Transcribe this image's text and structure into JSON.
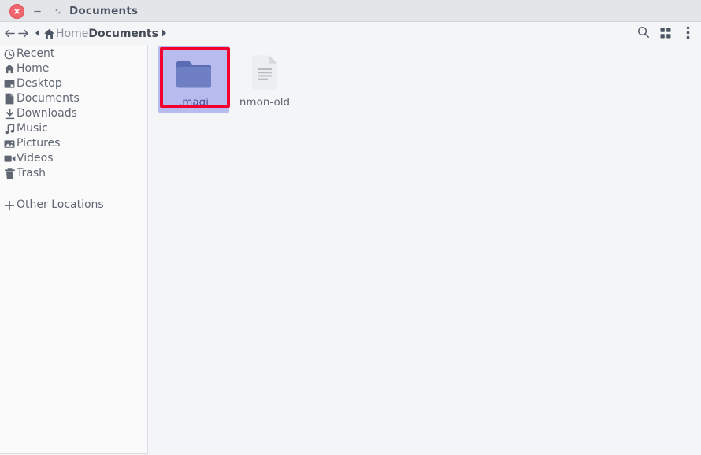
{
  "window": {
    "title": "Documents",
    "controls": [
      {
        "name": "close-button",
        "icon": "close-icon",
        "label": "Close"
      },
      {
        "name": "minimize-button",
        "icon": "minimize-icon",
        "label": "Minimize"
      },
      {
        "name": "maximize-button",
        "icon": "maximize-icon",
        "label": "Maximize"
      }
    ]
  },
  "pathbar": {
    "back_label": "Back",
    "forward_label": "Forward",
    "prev_crumb_label": "Previous",
    "next_crumb_label": "Next",
    "home_icon": "home-icon",
    "crumbs": [
      {
        "label": "Home",
        "active": false
      },
      {
        "label": "Documents",
        "active": true
      }
    ]
  },
  "toolbar": {
    "buttons": [
      {
        "name": "search-button",
        "icon": "search-icon",
        "label": "Search"
      },
      {
        "name": "view-grid-button",
        "icon": "grid-icon",
        "label": "View options"
      },
      {
        "name": "menu-button",
        "icon": "kebab-menu-icon",
        "label": "Menu"
      }
    ]
  },
  "sidebar": {
    "items": [
      {
        "label": "Recent",
        "icon": "clock-icon"
      },
      {
        "label": "Home",
        "icon": "home-icon"
      },
      {
        "label": "Desktop",
        "icon": "desktop-icon"
      },
      {
        "label": "Documents",
        "icon": "document-icon"
      },
      {
        "label": "Downloads",
        "icon": "download-arrow-icon"
      },
      {
        "label": "Music",
        "icon": "music-note-icon"
      },
      {
        "label": "Pictures",
        "icon": "picture-icon"
      },
      {
        "label": "Videos",
        "icon": "video-camera-icon"
      },
      {
        "label": "Trash",
        "icon": "trash-icon"
      }
    ],
    "other_locations": {
      "label": "Other Locations",
      "icon": "plus-icon"
    }
  },
  "files": [
    {
      "name": ".magi",
      "type": "folder",
      "icon": "folder-icon",
      "selected": true
    },
    {
      "name": "nmon-old",
      "type": "document",
      "icon": "text-document-icon",
      "selected": false
    }
  ],
  "colors": {
    "titlebar_bg": "#e4e5e9",
    "content_bg": "#f4f5f7",
    "sidebar_bg": "#fafafb",
    "selection_bg": "#b7bbee",
    "folder_body": "#6f7fc4",
    "folder_tab": "#5a6cb4",
    "close_button": "#f0666f",
    "highlight_border": "#f5002e",
    "text": "#5f6672",
    "text_active": "#434a56"
  }
}
